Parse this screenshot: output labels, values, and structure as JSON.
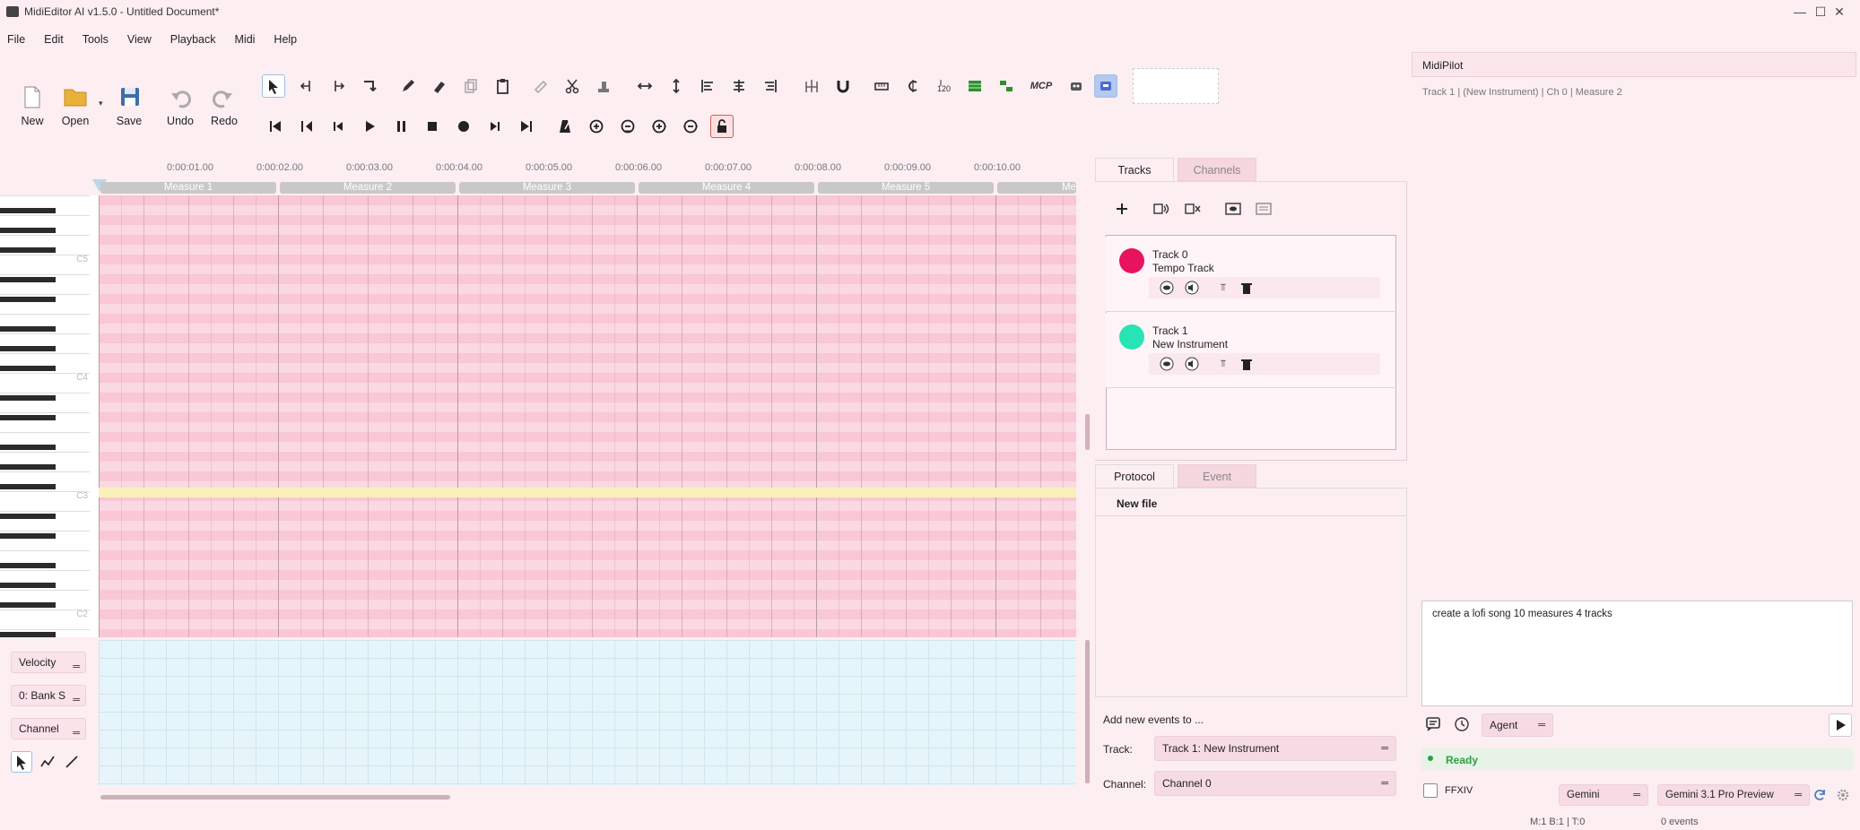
{
  "window": {
    "title": "MidiEditor AI v1.5.0 - Untitled Document*",
    "minimize": "—",
    "maximize": "☐",
    "close": "✕"
  },
  "menu": [
    "File",
    "Edit",
    "Tools",
    "View",
    "Playback",
    "Midi",
    "Help"
  ],
  "toolbar": {
    "new": "New",
    "open": "Open",
    "save": "Save",
    "undo": "Undo",
    "redo": "Redo",
    "mcp": "MCP"
  },
  "timeline": {
    "times": [
      "0:00:01.00",
      "0:00:02.00",
      "0:00:03.00",
      "0:00:04.00",
      "0:00:05.00",
      "0:00:06.00",
      "0:00:07.00",
      "0:00:08.00",
      "0:00:09.00",
      "0:00:10.00"
    ],
    "measures": [
      "Measure 1",
      "Measure 2",
      "Measure 3",
      "Measure 4",
      "Measure 5",
      "Me"
    ]
  },
  "piano": {
    "labels": [
      "C5",
      "C4",
      "C3",
      "C2"
    ]
  },
  "controls": {
    "velocity": "Velocity",
    "bank": "0: Bank S",
    "channel": "Channel"
  },
  "tracks_panel": {
    "tabs": [
      "Tracks",
      "Channels"
    ],
    "tracks": [
      {
        "number": "Track 0",
        "name": "Tempo Track",
        "color": "#e8135e"
      },
      {
        "number": "Track 1",
        "name": "New Instrument",
        "color": "#28e3b4"
      }
    ]
  },
  "protocol_panel": {
    "tabs": [
      "Protocol",
      "Event"
    ],
    "item": "New file"
  },
  "add_events": {
    "heading": "Add new events to ...",
    "track_label": "Track:",
    "track_value": "Track 1: New Instrument",
    "channel_label": "Channel:",
    "channel_value": "Channel 0"
  },
  "midipilot": {
    "title": "MidiPilot",
    "context": "Track 1 | (New Instrument) | Ch 0 | Measure 2",
    "prompt": "create a lofi song 10 measures 4 tracks",
    "mode": "Agent",
    "status": "Ready",
    "status_color": "#2f9e44",
    "ffxiv_label": "FFXIV",
    "provider": "Gemini",
    "model": "Gemini 3.1 Pro Preview"
  },
  "statusbar": {
    "position": "M:1 B:1 | T:0",
    "events": "0 events"
  }
}
